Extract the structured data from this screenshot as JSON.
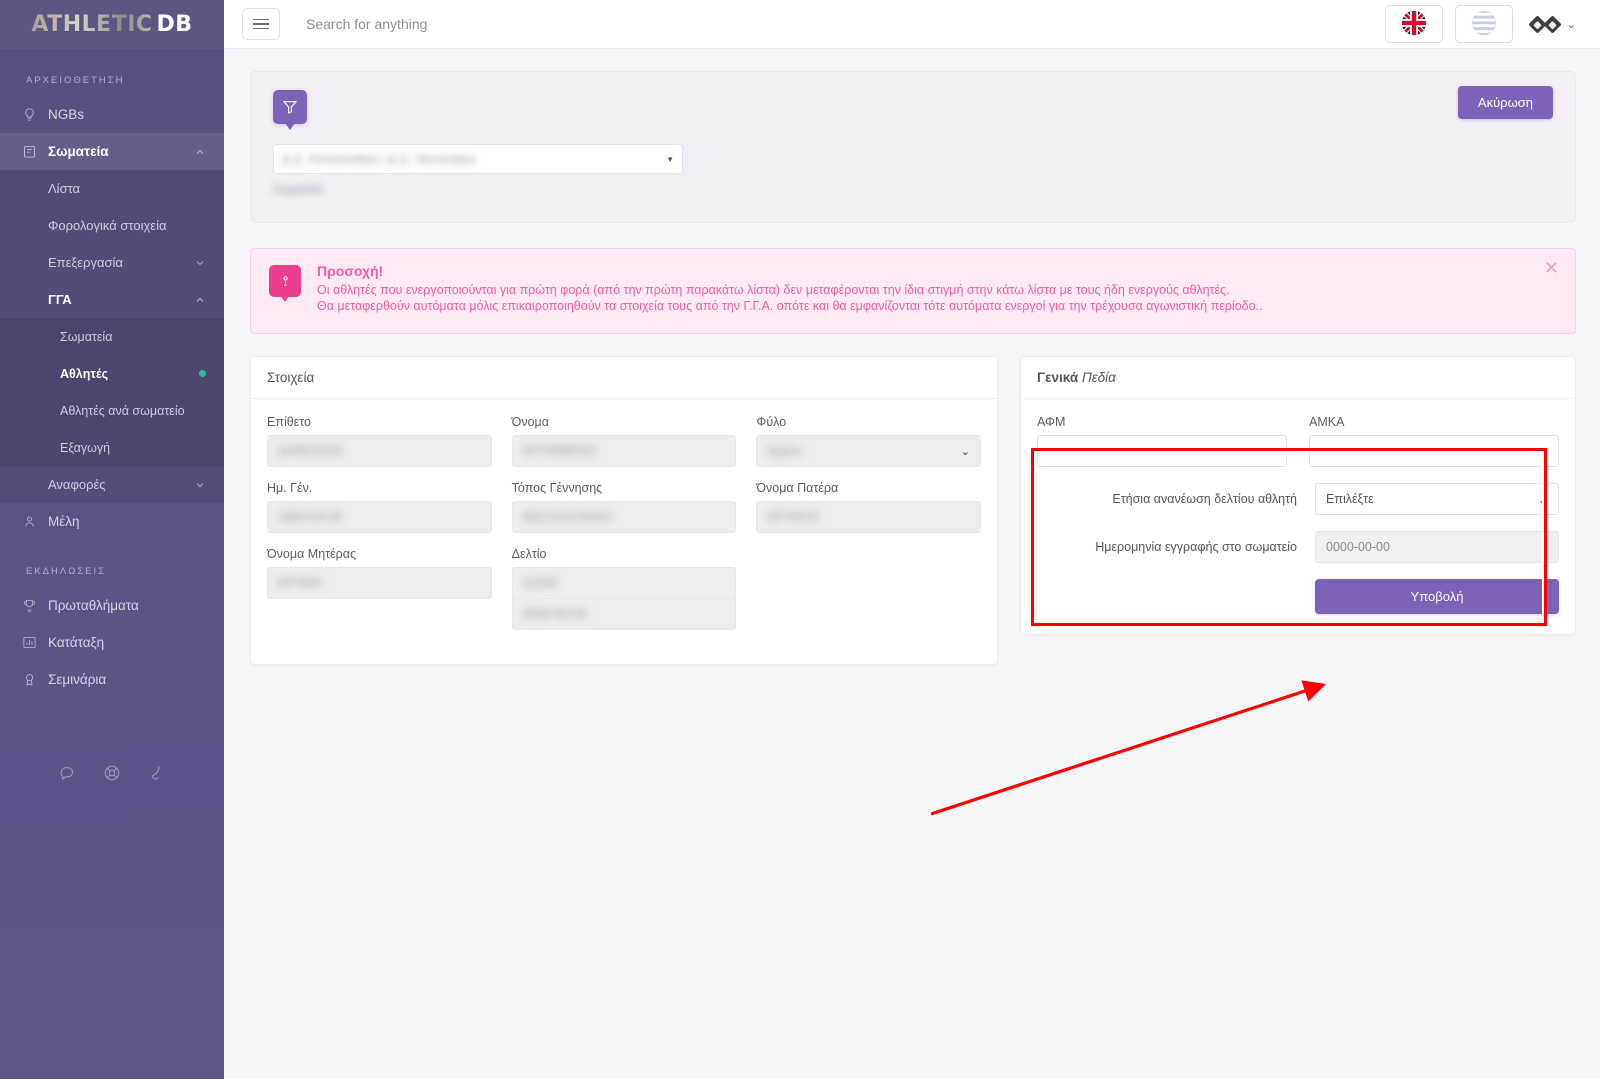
{
  "brand": {
    "part1": "ATHLETIC",
    "part2": "DB"
  },
  "sidebar": {
    "section1": "ΑΡΧΕΙΟΘΕΤΗΣΗ",
    "section2": "ΕΚΔΗΛΩΣΕΙΣ",
    "items": {
      "ngbs": "NGBs",
      "somateia": "Σωματεία",
      "lista": "Λίστα",
      "forologika": "Φορολογικά στοιχεία",
      "epexergasia": "Επεξεργασία",
      "gga": "ΓΓΑ",
      "gga_somateia": "Σωματεία",
      "gga_athlites": "Αθλητές",
      "gga_athlites_ana": "Αθλητές ανά σωματείο",
      "gga_exagogi": "Εξαγωγή",
      "anafores": "Αναφορές",
      "meli": "Μέλη",
      "protathlimata": "Πρωταθλήματα",
      "katataxi": "Κατάταξη",
      "seminaria": "Σεμινάρια"
    },
    "social": [
      "chat-icon",
      "support-icon",
      "phone-icon"
    ]
  },
  "topbar": {
    "menu_icon": "hamburger-icon",
    "search_placeholder": "Search for anything",
    "search_value": "",
    "lang_en": "uk-flag-icon",
    "lang_el": "greece-flag-icon",
    "user_menu": "user-diamonds-icon"
  },
  "filter": {
    "icon": "filter-icon",
    "cancel_label": "Ακύρωση",
    "select_value": "Α.Σ. ΡΙΛΟΛΗΝΟ / Α.Σ. ΤΕΛΙΛΙΚΟ",
    "select_caption": "Σωματείο"
  },
  "alert": {
    "icon": "info-badge-icon",
    "title": "Προσοχή!",
    "line1": "Οι αθλητές που ενεργοποιούνται για πρώτη φορά (από την πρώτη παρακάτω λίστα) δεν μεταφέρονται την ίδια στιγμή στην κάτω λίστα με τους ήδη ενεργούς αθλητές.",
    "line2": "Θα μεταφερθούν αυτόματα μόλις επικαιροποιηθούν τα στοιχεία τους από την Γ.Γ.Α. οπότε και θα εμφανίζονται τότε αυτόματα ενεργοί για την τρέχουσα αγωνιστική περίοδο..",
    "close": "✕"
  },
  "details_card": {
    "title": "Στοιχεία",
    "fields": {
      "epitheto_label": "Επίθετο",
      "epitheto_value": "ΔΗΜΟΣΙΟΣ",
      "onoma_label": "Όνομα",
      "onoma_value": "ΚΡΥΜΜΕΝΟ",
      "fylo_label": "Φύλο",
      "fylo_value": "Άρρεν",
      "imgen_label": "Ημ. Γέν.",
      "imgen_value": "1980-00-00",
      "topos_label": "Τόπος Γέννησης",
      "topos_value": "ΘΕΣΣΑΛΟΝΙΚΗ",
      "patera_label": "Όνομα Πατέρα",
      "patera_value": "ΚΡΥΦΟΣ",
      "mitera_label": "Όνομα Μητέρας",
      "mitera_value": "ΚΡΥΦΗ",
      "deltio_label": "Δελτίο",
      "deltio_value1": "12345",
      "deltio_value2": "0000-00-00"
    }
  },
  "general_card": {
    "title_bold": "Γενικά",
    "title_italic": "Πεδία",
    "afm_label": "ΑΦΜ",
    "afm_value": "",
    "amka_label": "ΑΜΚΑ",
    "amka_value": "",
    "renew_label": "Ετήσια ανανέωση δελτίου αθλητή",
    "renew_value": "Επιλέξτε",
    "regdate_label": "Ημερομηνία εγγραφής στο σωματείο",
    "regdate_value": "0000-00-00",
    "submit_label": "Υποβολή"
  },
  "annotations": {
    "highlight_color": "#fe0000",
    "arrow": "red-arrow-pointing-to-submit"
  },
  "colors": {
    "accent": "#7d63b8",
    "sidebar": "#5b5386",
    "alert_pink": "#ea3f8e",
    "page_bg": "#f7f6f9"
  }
}
